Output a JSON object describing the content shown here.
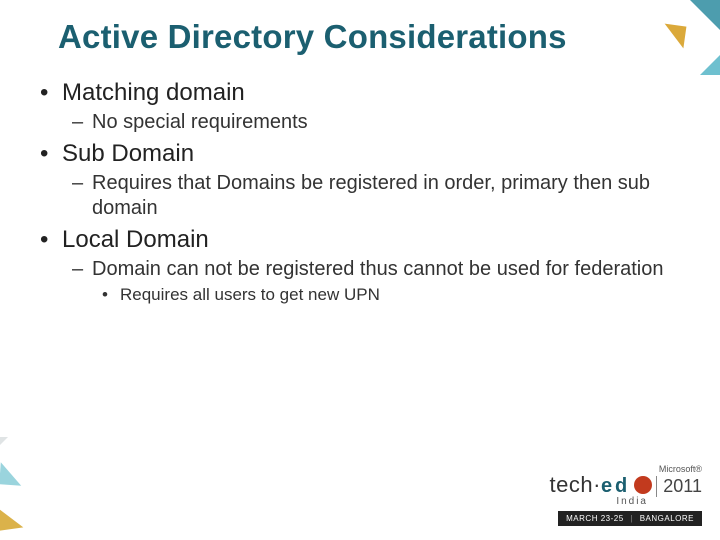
{
  "title": "Active Directory Considerations",
  "bullets": {
    "b1": {
      "label": "Matching domain",
      "sub": {
        "s1": "No special requirements"
      }
    },
    "b2": {
      "label": "Sub Domain",
      "sub": {
        "s1": "Requires that Domains be registered in order, primary then sub domain"
      }
    },
    "b3": {
      "label": "Local Domain",
      "sub": {
        "s1": "Domain can not be registered thus cannot be used for federation",
        "s1sub": {
          "a": "Requires all users to get new UPN"
        }
      }
    }
  },
  "footer": {
    "ms": "Microsoft®",
    "tech": "tech·",
    "ed": "ed",
    "india": "India",
    "year": "2011",
    "bar_dates": "MARCH 23-25",
    "bar_city": "BANGALORE"
  }
}
